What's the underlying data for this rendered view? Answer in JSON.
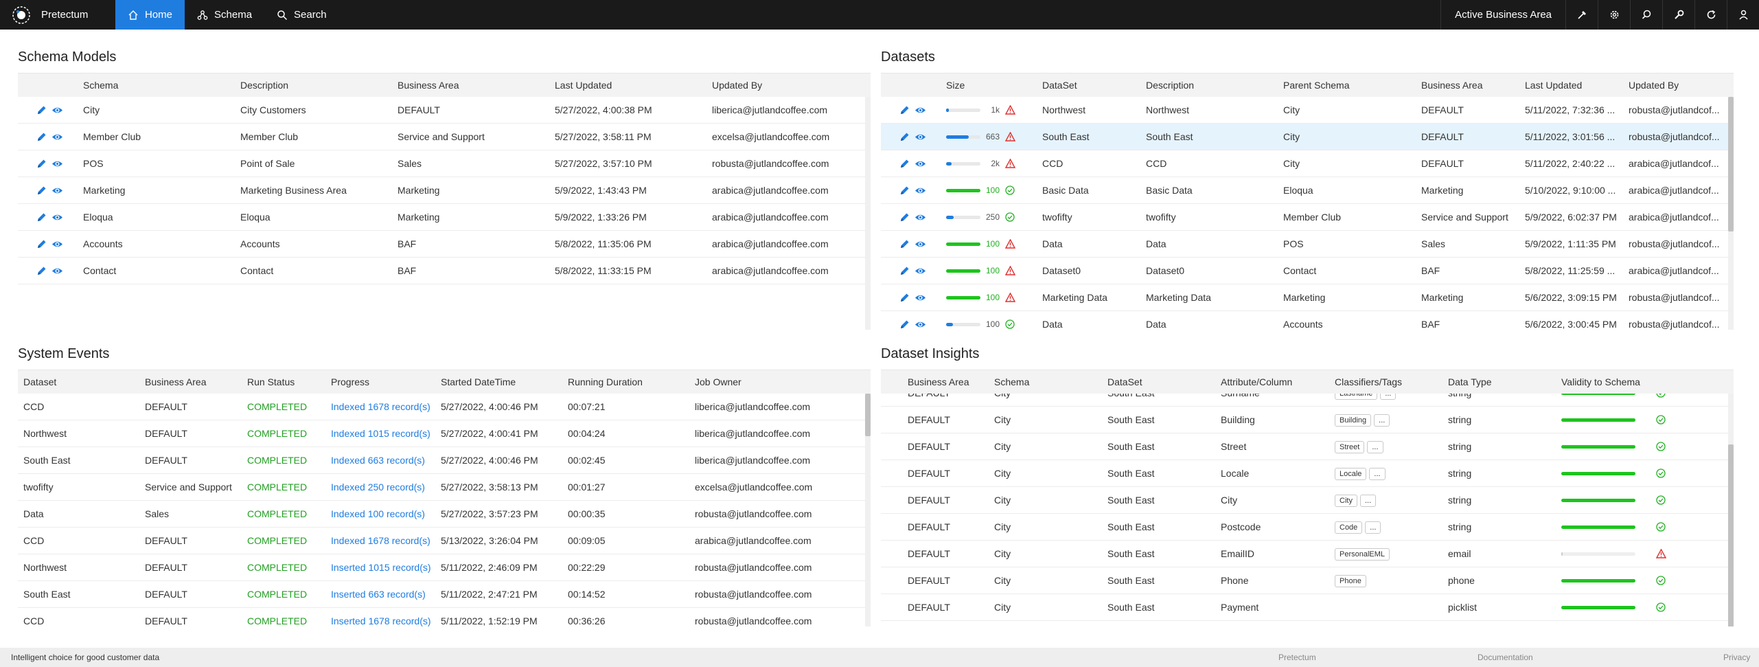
{
  "nav": {
    "brand": "Pretectum",
    "items": [
      {
        "label": "Home",
        "icon": "home-icon",
        "active": true
      },
      {
        "label": "Schema",
        "icon": "schema-icon",
        "active": false
      },
      {
        "label": "Search",
        "icon": "search-icon",
        "active": false
      }
    ],
    "area_button": "Active Business Area",
    "right_icons": [
      "wand-icon",
      "gear-icon",
      "search-icon",
      "wrench-icon",
      "refresh-icon",
      "user-icon"
    ]
  },
  "schema_models": {
    "title": "Schema Models",
    "columns": [
      "Schema",
      "Description",
      "Business Area",
      "Last Updated",
      "Updated By"
    ],
    "rows": [
      [
        "City",
        "City Customers",
        "DEFAULT",
        "5/27/2022, 4:00:38 PM",
        "liberica@jutlandcoffee.com"
      ],
      [
        "Member Club",
        "Member Club",
        "Service and Support",
        "5/27/2022, 3:58:11 PM",
        "excelsa@jutlandcoffee.com"
      ],
      [
        "POS",
        "Point of Sale",
        "Sales",
        "5/27/2022, 3:57:10 PM",
        "robusta@jutlandcoffee.com"
      ],
      [
        "Marketing",
        "Marketing Business Area",
        "Marketing",
        "5/9/2022, 1:43:43 PM",
        "arabica@jutlandcoffee.com"
      ],
      [
        "Eloqua",
        "Eloqua",
        "Marketing",
        "5/9/2022, 1:33:26 PM",
        "arabica@jutlandcoffee.com"
      ],
      [
        "Accounts",
        "Accounts",
        "BAF",
        "5/8/2022, 11:35:06 PM",
        "arabica@jutlandcoffee.com"
      ],
      [
        "Contact",
        "Contact",
        "BAF",
        "5/8/2022, 11:33:15 PM",
        "arabica@jutlandcoffee.com"
      ]
    ]
  },
  "datasets": {
    "title": "Datasets",
    "columns": [
      "Size",
      "DataSet",
      "Description",
      "Parent Schema",
      "Business Area",
      "Last Updated",
      "Updated By"
    ],
    "rows": [
      {
        "size": "1k",
        "fill": 0.08,
        "status": "warning",
        "dataset": "Northwest",
        "description": "Northwest",
        "schema": "City",
        "area": "DEFAULT",
        "updated": "5/11/2022, 7:32:36 ...",
        "by": "robusta@jutlandcof...",
        "selected": false
      },
      {
        "size": "663",
        "fill": 0.65,
        "status": "warning",
        "dataset": "South East",
        "description": "South East",
        "schema": "City",
        "area": "DEFAULT",
        "updated": "5/11/2022, 3:01:56 ...",
        "by": "robusta@jutlandcof...",
        "selected": true
      },
      {
        "size": "2k",
        "fill": 0.15,
        "status": "warning",
        "dataset": "CCD",
        "description": "CCD",
        "schema": "City",
        "area": "DEFAULT",
        "updated": "5/11/2022, 2:40:22 ...",
        "by": "arabica@jutlandcof...",
        "selected": false
      },
      {
        "size": "100",
        "fill": 1.0,
        "status": "ok",
        "dataset": "Basic Data",
        "description": "Basic Data",
        "schema": "Eloqua",
        "area": "Marketing",
        "updated": "5/10/2022, 9:10:00 ...",
        "by": "arabica@jutlandcof...",
        "selected": false
      },
      {
        "size": "250",
        "fill": 0.22,
        "status": "ok",
        "dataset": "twofifty",
        "description": "twofifty",
        "schema": "Member Club",
        "area": "Service and Support",
        "updated": "5/9/2022, 6:02:37 PM",
        "by": "arabica@jutlandcof...",
        "selected": false
      },
      {
        "size": "100",
        "fill": 1.0,
        "status": "warning",
        "dataset": "Data",
        "description": "Data",
        "schema": "POS",
        "area": "Sales",
        "updated": "5/9/2022, 1:11:35 PM",
        "by": "robusta@jutlandcof...",
        "selected": false
      },
      {
        "size": "100",
        "fill": 1.0,
        "status": "warning",
        "dataset": "Dataset0",
        "description": "Dataset0",
        "schema": "Contact",
        "area": "BAF",
        "updated": "5/8/2022, 11:25:59 ...",
        "by": "arabica@jutlandcof...",
        "selected": false
      },
      {
        "size": "100",
        "fill": 1.0,
        "status": "warning",
        "dataset": "Marketing Data",
        "description": "Marketing Data",
        "schema": "Marketing",
        "area": "Marketing",
        "updated": "5/6/2022, 3:09:15 PM",
        "by": "robusta@jutlandcof...",
        "selected": false
      },
      {
        "size": "100",
        "fill": 0.2,
        "status": "ok",
        "dataset": "Data",
        "description": "Data",
        "schema": "Accounts",
        "area": "BAF",
        "updated": "5/6/2022, 3:00:45 PM",
        "by": "robusta@jutlandcof...",
        "selected": false
      }
    ]
  },
  "system_events": {
    "title": "System Events",
    "columns": [
      "Dataset",
      "Business Area",
      "Run Status",
      "Progress",
      "Started DateTime",
      "Running Duration",
      "Job Owner"
    ],
    "rows": [
      [
        "CCD",
        "DEFAULT",
        "COMPLETED",
        "Indexed 1678 record(s)",
        "5/27/2022, 4:00:46 PM",
        "00:07:21",
        "liberica@jutlandcoffee.com"
      ],
      [
        "Northwest",
        "DEFAULT",
        "COMPLETED",
        "Indexed 1015 record(s)",
        "5/27/2022, 4:00:41 PM",
        "00:04:24",
        "liberica@jutlandcoffee.com"
      ],
      [
        "South East",
        "DEFAULT",
        "COMPLETED",
        "Indexed 663 record(s)",
        "5/27/2022, 4:00:46 PM",
        "00:02:45",
        "liberica@jutlandcoffee.com"
      ],
      [
        "twofifty",
        "Service and Support",
        "COMPLETED",
        "Indexed 250 record(s)",
        "5/27/2022, 3:58:13 PM",
        "00:01:27",
        "excelsa@jutlandcoffee.com"
      ],
      [
        "Data",
        "Sales",
        "COMPLETED",
        "Indexed 100 record(s)",
        "5/27/2022, 3:57:23 PM",
        "00:00:35",
        "robusta@jutlandcoffee.com"
      ],
      [
        "CCD",
        "DEFAULT",
        "COMPLETED",
        "Indexed 1678 record(s)",
        "5/13/2022, 3:26:04 PM",
        "00:09:05",
        "arabica@jutlandcoffee.com"
      ],
      [
        "Northwest",
        "DEFAULT",
        "COMPLETED",
        "Inserted 1015 record(s)",
        "5/11/2022, 2:46:09 PM",
        "00:22:29",
        "robusta@jutlandcoffee.com"
      ],
      [
        "South East",
        "DEFAULT",
        "COMPLETED",
        "Inserted 663 record(s)",
        "5/11/2022, 2:47:21 PM",
        "00:14:52",
        "robusta@jutlandcoffee.com"
      ],
      [
        "CCD",
        "DEFAULT",
        "COMPLETED",
        "Inserted 1678 record(s)",
        "5/11/2022, 1:52:19 PM",
        "00:36:26",
        "robusta@jutlandcoffee.com"
      ]
    ]
  },
  "dataset_insights": {
    "title": "Dataset Insights",
    "columns": [
      "Business Area",
      "Schema",
      "DataSet",
      "Attribute/Column",
      "Classifiers/Tags",
      "Data Type",
      "Validity to Schema"
    ],
    "rows": [
      {
        "area": "DEFAULT",
        "schema": "City",
        "dataset": "South East",
        "attribute": "Surname",
        "tags": [
          "Lastname",
          "..."
        ],
        "type": "string",
        "validity": 1.0,
        "status": "ok"
      },
      {
        "area": "DEFAULT",
        "schema": "City",
        "dataset": "South East",
        "attribute": "Building",
        "tags": [
          "Building",
          "..."
        ],
        "type": "string",
        "validity": 1.0,
        "status": "ok"
      },
      {
        "area": "DEFAULT",
        "schema": "City",
        "dataset": "South East",
        "attribute": "Street",
        "tags": [
          "Street",
          "..."
        ],
        "type": "string",
        "validity": 1.0,
        "status": "ok"
      },
      {
        "area": "DEFAULT",
        "schema": "City",
        "dataset": "South East",
        "attribute": "Locale",
        "tags": [
          "Locale",
          "..."
        ],
        "type": "string",
        "validity": 1.0,
        "status": "ok"
      },
      {
        "area": "DEFAULT",
        "schema": "City",
        "dataset": "South East",
        "attribute": "City",
        "tags": [
          "City",
          "..."
        ],
        "type": "string",
        "validity": 1.0,
        "status": "ok"
      },
      {
        "area": "DEFAULT",
        "schema": "City",
        "dataset": "South East",
        "attribute": "Postcode",
        "tags": [
          "Code",
          "..."
        ],
        "type": "string",
        "validity": 1.0,
        "status": "ok"
      },
      {
        "area": "DEFAULT",
        "schema": "City",
        "dataset": "South East",
        "attribute": "EmailID",
        "tags": [
          "PersonalEML"
        ],
        "type": "email",
        "validity": 0.02,
        "status": "warning"
      },
      {
        "area": "DEFAULT",
        "schema": "City",
        "dataset": "South East",
        "attribute": "Phone",
        "tags": [
          "Phone"
        ],
        "type": "phone",
        "validity": 1.0,
        "status": "ok"
      },
      {
        "area": "DEFAULT",
        "schema": "City",
        "dataset": "South East",
        "attribute": "Payment",
        "tags": [],
        "type": "picklist",
        "validity": 1.0,
        "status": "ok"
      }
    ]
  },
  "footer": {
    "tagline": "Intelligent choice for good customer data",
    "links": [
      "Pretectum",
      "Documentation",
      "Privacy"
    ]
  },
  "colors": {
    "accent": "#1f7de0",
    "success": "#22b022",
    "warning": "#e03030",
    "nav_bg": "#1a1a1a"
  }
}
